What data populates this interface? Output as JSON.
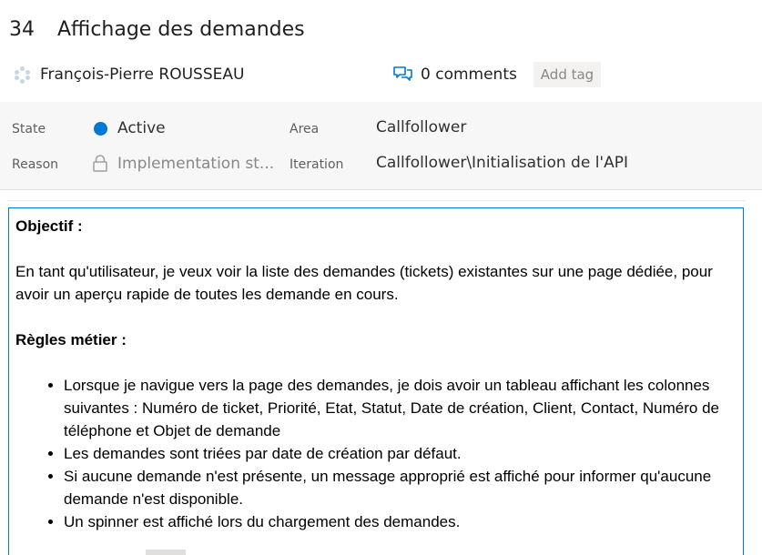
{
  "work_item": {
    "id": "34",
    "title": "Affichage des demandes"
  },
  "author": {
    "name": "François-Pierre ROUSSEAU",
    "avatar_icon": "avatar-placeholder-icon"
  },
  "comments": {
    "label": "0 comments",
    "icon": "comments-icon"
  },
  "tags": {
    "add_label": "Add tag"
  },
  "fields": {
    "state_label": "State",
    "state_value": "Active",
    "state_color": "#0078d4",
    "reason_label": "Reason",
    "reason_value": "Implementation st...",
    "area_label": "Area",
    "area_value": "Callfollower",
    "iteration_label": "Iteration",
    "iteration_value": "Callfollower\\Initialisation de l'API"
  },
  "description": {
    "objective_heading": "Objectif :",
    "objective_text": "En tant qu'utilisateur, je veux voir la liste des demandes (tickets) existantes sur une page dédiée, pour avoir un aperçu rapide de toutes les demande en cours.",
    "rules_heading": "Règles métier :",
    "rules": [
      "Lorsque je navigue vers la page des demandes, je dois avoir un tableau affichant les colonnes suivantes : Numéro de ticket, Priorité, Etat, Statut, Date de création, Client, Contact, Numéro de téléphone et Objet de demande",
      "Les demandes sont triées par date de création par défaut.",
      "Si aucune demande n'est présente, un message approprié est affiché pour informer qu'aucune demande n'est disponible.",
      "Un spinner est affiché lors du chargement des demandes."
    ]
  },
  "colors": {
    "accent": "#0078d4",
    "fields_background": "#f7f7f7"
  }
}
